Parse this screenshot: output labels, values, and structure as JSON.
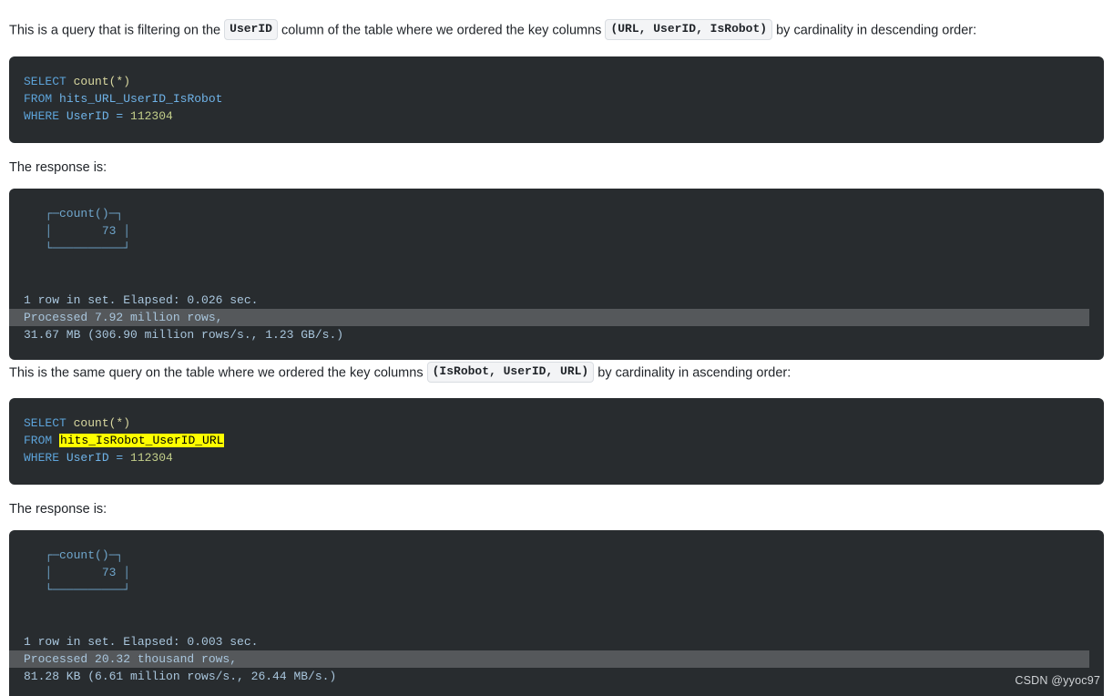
{
  "paragraphs": {
    "p1_before": "This is a query that is filtering on the ",
    "p1_chip": "UserID",
    "p1_middle": " column of the table where we ordered the key columns ",
    "p1_chip2": "(URL, UserID, IsRobot)",
    "p1_after": " by cardinality in descending order:",
    "p2": "The response is:",
    "p3_before": "This is the same query on the table where we ordered the key columns ",
    "p3_chip": "(IsRobot, UserID, URL)",
    "p3_after": " by cardinality in ascending order:",
    "p4": "The response is:"
  },
  "sql1": {
    "kw_select": "SELECT",
    "fn_count": " count(*)",
    "kw_from": "FROM",
    "table": " hits_URL_UserID_IsRobot",
    "kw_where": "WHERE",
    "where_col": " UserID = ",
    "where_val": "112304"
  },
  "sql2": {
    "kw_select": "SELECT",
    "fn_count": " count(*)",
    "kw_from": "FROM",
    "table_highlighted": "hits_IsRobot_UserID_URL",
    "kw_where": "WHERE",
    "where_col": " UserID = ",
    "where_val": "112304"
  },
  "console1": {
    "header_top": "   ┌─count()─┐",
    "row_value": "   │       73 │",
    "footer": "   └──────────┘",
    "blank": " ",
    "elapsed": "1 row in set. Elapsed: 0.026 sec.",
    "processed": "Processed 7.92 million rows,",
    "throughput": "31.67 MB (306.90 million rows/s., 1.23 GB/s.)"
  },
  "console2": {
    "header_top": "   ┌─count()─┐",
    "row_value": "   │       73 │",
    "footer": "   └──────────┘",
    "blank": " ",
    "elapsed": "1 row in set. Elapsed: 0.003 sec.",
    "processed": "Processed 20.32 thousand rows,",
    "throughput": "81.28 KB (6.61 million rows/s., 26.44 MB/s.)"
  },
  "watermark": "CSDN @yyoc97",
  "colors": {
    "code_background": "#282c2f",
    "keyword": "#5da3d9",
    "identifier": "#6fb3e8",
    "function": "#d9d8a0",
    "number": "#c3cf8a",
    "console_text": "#a9c6dd",
    "box_drawing": "#6fa6cc",
    "highlight_yellow": "#ffff00",
    "highlight_row": "#55585b",
    "chip_background": "#f3f4f6",
    "page_text": "#1f2328"
  }
}
